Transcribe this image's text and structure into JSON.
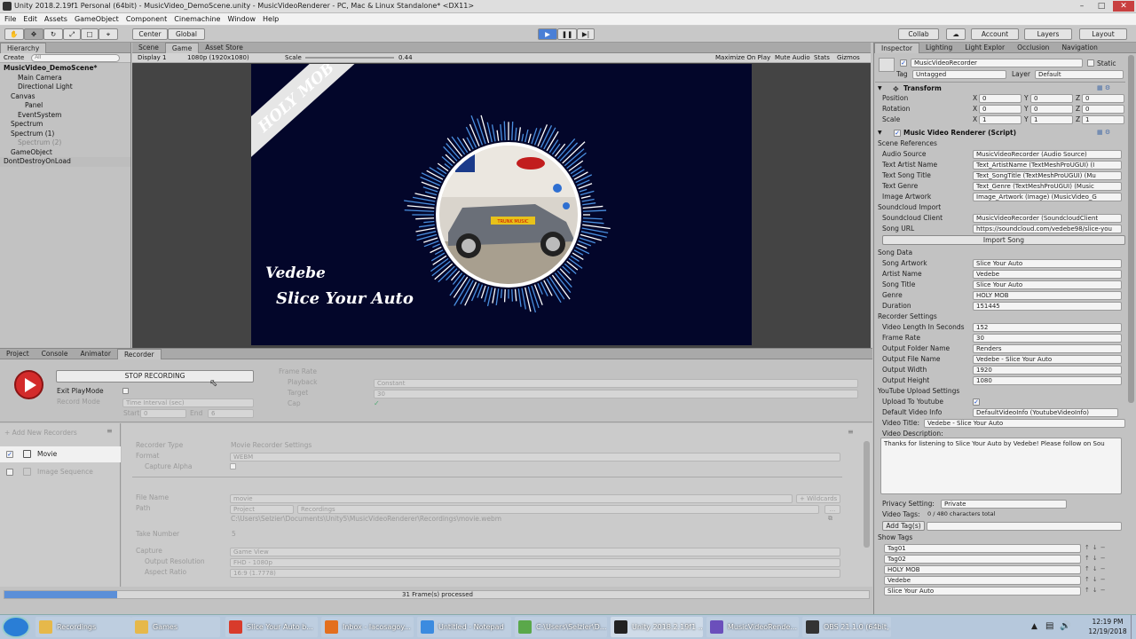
{
  "window": {
    "title": "Unity 2018.2.19f1 Personal (64bit) - MusicVideo_DemoScene.unity - MusicVideoRenderer - PC, Mac & Linux Standalone* <DX11>",
    "menu": [
      "File",
      "Edit",
      "Assets",
      "GameObject",
      "Component",
      "Cinemachine",
      "Window",
      "Help"
    ]
  },
  "toolbar": {
    "pivot": "Center",
    "space": "Global",
    "collab": "Collab",
    "account": "Account",
    "layers": "Layers",
    "layout": "Layout"
  },
  "hierarchy": {
    "tab": "Hierarchy",
    "create": "Create",
    "search_placeholder": "All",
    "items": [
      {
        "label": "MusicVideo_DemoScene*",
        "indent": 0
      },
      {
        "label": "Main Camera",
        "indent": 2
      },
      {
        "label": "Directional Light",
        "indent": 2
      },
      {
        "label": "Canvas",
        "indent": 1
      },
      {
        "label": "Panel",
        "indent": 3
      },
      {
        "label": "EventSystem",
        "indent": 2
      },
      {
        "label": "Spectrum",
        "indent": 1
      },
      {
        "label": "Spectrum (1)",
        "indent": 1
      },
      {
        "label": "Spectrum (2)",
        "indent": 2
      },
      {
        "label": "GameObject",
        "indent": 1
      },
      {
        "label": "DontDestroyOnLoad",
        "indent": 0
      }
    ]
  },
  "scene_tabs": [
    "Scene",
    "Game",
    "Asset Store"
  ],
  "game_bar": {
    "display": "Display 1",
    "resolution": "1080p (1920x1080)",
    "scale_label": "Scale",
    "scale_value": "0.44",
    "maximize": "Maximize On Play",
    "mute": "Mute Audio",
    "stats": "Stats",
    "gizmos": "Gizmos"
  },
  "game_view": {
    "corner_banner": "HOLY MOB",
    "artist": "Vedebe",
    "song": "Slice Your Auto",
    "art_caption": "TRUNK MUSIC"
  },
  "bottom_tabs": [
    "Project",
    "Console",
    "Animator",
    "Recorder"
  ],
  "recorder": {
    "stop_button": "STOP RECORDING",
    "exit_playmode": "Exit PlayMode",
    "record_mode_label": "Record Mode",
    "record_mode_value": "Time Interval (sec)",
    "start_label": "Start",
    "start_value": "0",
    "end_label": "End",
    "end_value": "6",
    "frame_rate_header": "Frame Rate",
    "playback_label": "Playback",
    "playback_value": "Constant",
    "target_label": "Target",
    "target_value": "30",
    "cap_label": "Cap",
    "add_new": "+ Add New Recorders",
    "recorders": [
      {
        "label": "Movie",
        "checked": true
      },
      {
        "label": "Image Sequence",
        "checked": false
      }
    ],
    "recorder_type_label": "Recorder Type",
    "recorder_type_value": "Movie Recorder Settings",
    "format_label": "Format",
    "format_value": "WEBM",
    "capture_alpha": "Capture Alpha",
    "file_name_label": "File Name",
    "file_name_value": "movie",
    "wildcards": "+ Wildcards",
    "path_label": "Path",
    "path_root": "Project",
    "path_value": "Recordings",
    "path_browse": "...",
    "full_path": "C:\\Users\\Selzier\\Documents\\Unity5\\MusicVideoRenderer\\Recordings\\movie.webm",
    "take_label": "Take Number",
    "take_value": "5",
    "capture_label": "Capture",
    "capture_value": "Game View",
    "output_res_label": "Output Resolution",
    "output_res_value": "FHD - 1080p",
    "aspect_label": "Aspect Ratio",
    "aspect_value": "16:9 (1.7778)",
    "progress_text": "31 Frame(s) processed",
    "progress_fraction": 0.13
  },
  "inspector": {
    "tabs": [
      "Inspector",
      "Lighting",
      "Light Explor",
      "Occlusion",
      "Navigation"
    ],
    "object_name": "MusicVideoRecorder",
    "static": "Static",
    "tag_label": "Tag",
    "tag_value": "Untagged",
    "layer_label": "Layer",
    "layer_value": "Default",
    "transform": {
      "header": "Transform",
      "rows": [
        {
          "label": "Position",
          "x": "0",
          "y": "0",
          "z": "0"
        },
        {
          "label": "Rotation",
          "x": "0",
          "y": "0",
          "z": "0"
        },
        {
          "label": "Scale",
          "x": "1",
          "y": "1",
          "z": "1"
        }
      ]
    },
    "script_header": "Music Video Renderer (Script)",
    "scene_refs_header": "Scene References",
    "scene_refs": [
      {
        "label": "Audio Source",
        "value": "MusicVideoRecorder (Audio Source)"
      },
      {
        "label": "Text Artist Name",
        "value": "Text_ArtistName (TextMeshProUGUI) (I"
      },
      {
        "label": "Text Song Title",
        "value": "Text_SongTitle (TextMeshProUGUI) (Mu"
      },
      {
        "label": "Text Genre",
        "value": "Text_Genre (TextMeshProUGUI) (Music"
      },
      {
        "label": "Image Artwork",
        "value": "Image_Artwork (Image) (MusicVideo_G"
      }
    ],
    "soundcloud_header": "Soundcloud Import",
    "soundcloud": [
      {
        "label": "Soundcloud Client",
        "value": "MusicVideoRecorder (SoundcloudClient"
      },
      {
        "label": "Song URL",
        "value": "https://soundcloud.com/vedebe98/slice-you"
      }
    ],
    "import_button": "Import Song",
    "song_data_header": "Song Data",
    "song_data": [
      {
        "label": "Song Artwork",
        "value": "Slice Your Auto"
      },
      {
        "label": "Artist Name",
        "value": "Vedebe"
      },
      {
        "label": "Song Title",
        "value": "Slice Your Auto"
      },
      {
        "label": "Genre",
        "value": "HOLY MOB"
      },
      {
        "label": "Duration",
        "value": "151445"
      }
    ],
    "rec_settings_header": "Recorder Settings",
    "rec_settings": [
      {
        "label": "Video Length In Seconds",
        "value": "152"
      },
      {
        "label": "Frame Rate",
        "value": "30"
      },
      {
        "label": "Output Folder Name",
        "value": "Renders"
      },
      {
        "label": "Output File Name",
        "value": "Vedebe - Slice Your Auto"
      },
      {
        "label": "Output Width",
        "value": "1920"
      },
      {
        "label": "Output Height",
        "value": "1080"
      }
    ],
    "youtube_header": "YouTube Upload Settings",
    "upload_label": "Upload To Youtube",
    "default_info_label": "Default Video Info",
    "default_info_value": "DefaultVideoInfo (YoutubeVideoInfo)",
    "video_title_label": "Video Title:",
    "video_title_value": "Vedebe - Slice Your Auto",
    "video_desc_label": "Video Description:",
    "video_desc_value": "Thanks for listening to Slice Your Auto by Vedebe! Please follow on Sou",
    "privacy_label": "Privacy Setting:",
    "privacy_value": "Private",
    "video_tags_label": "Video Tags:",
    "video_tags_count": "0 / 480 characters total",
    "add_tags": "Add Tag(s)",
    "show_tags": "Show Tags",
    "tags": [
      "Tag01",
      "Tag02",
      "HOLY MOB",
      "Vedebe",
      "Slice Your Auto"
    ]
  },
  "taskbar": {
    "items": [
      "Recordings",
      "Games",
      "Slice Your Auto b...",
      "Inbox - lacosagoy...",
      "Untitled - Notepad",
      "C:\\Users\\Selzier\\D...",
      "Unity 2018.2.19f1 ...",
      "MusicVideoRende...",
      "OBS 21.1.0 (64bit, ..."
    ],
    "time": "12:19 PM",
    "date": "12/19/2018"
  }
}
